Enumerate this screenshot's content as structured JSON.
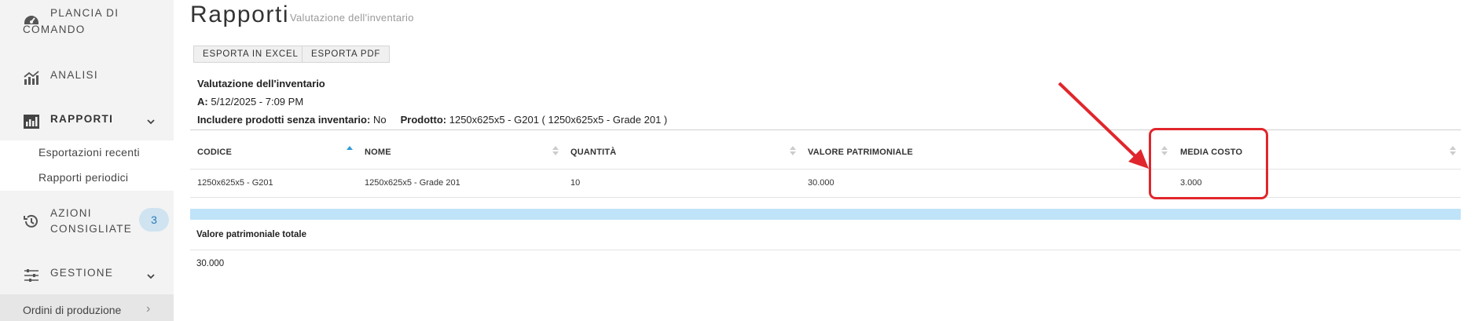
{
  "sidebar": {
    "items": [
      {
        "label_line1": "PLANCIA DI",
        "label_line2": "COMANDO",
        "icon": "dashboard-icon"
      },
      {
        "label": "ANALISI",
        "icon": "chart-icon"
      },
      {
        "label": "RAPPORTI",
        "icon": "report-icon",
        "expanded": true
      },
      {
        "label_line1": "AZIONI",
        "label_line2": "CONSIGLIATE",
        "icon": "history-icon",
        "badge": "3"
      },
      {
        "label": "GESTIONE",
        "icon": "sliders-icon"
      }
    ],
    "subitems": [
      "Esportazioni recenti",
      "Rapporti periodici"
    ],
    "footer_item": "Ordini di produzione"
  },
  "header": {
    "title": "Rapporti",
    "subtitle": "Valutazione dell'inventario"
  },
  "toolbar": {
    "export_excel": "ESPORTA IN EXCEL",
    "export_pdf": "ESPORTA PDF"
  },
  "report_info": {
    "title": "Valutazione dell'inventario",
    "date_label": "A:",
    "date_value": "5/12/2025 - 7:09 PM",
    "include_label": "Includere prodotti senza inventario:",
    "include_value": "No",
    "product_label": "Prodotto:",
    "product_value": "1250x625x5 - G201 ( 1250x625x5 - Grade 201 )"
  },
  "table": {
    "columns": [
      "CODICE",
      "NOME",
      "QUANTITÀ",
      "VALORE PATRIMONIALE",
      "MEDIA COSTO"
    ],
    "rows": [
      [
        "1250x625x5 - G201",
        "1250x625x5 - Grade 201",
        "10",
        "30.000",
        "3.000"
      ]
    ]
  },
  "totals": {
    "label": "Valore patrimoniale totale",
    "value": "30.000"
  },
  "colors": {
    "sidebar_bg": "#f3f3f3",
    "accent_blue": "#bfe3f8",
    "sort_active": "#2f9bd6",
    "annotation_red": "#e0262c"
  }
}
